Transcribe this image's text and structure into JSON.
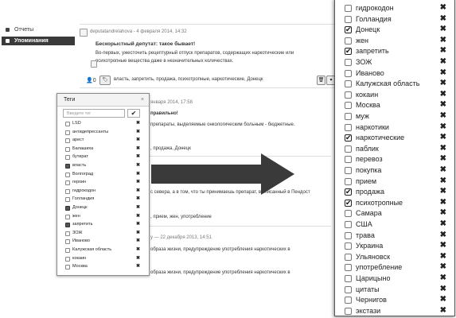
{
  "nav": {
    "items": [
      {
        "label": "Отчеты",
        "active": false
      },
      {
        "label": "Упоминания",
        "active": true
      }
    ]
  },
  "post": {
    "author_meta": "deputatandrelahova - 4 февраля 2014, 14:32",
    "title": "Бескорыстный депутат: такое бывает!",
    "body_line1": "Во-первых, ужесточить рецептурный отпуск препаратов, содержащих наркотические или",
    "body_line2": "психотропные вещества даже в незначительных количествах.",
    "count": "0",
    "tags_line": "власть, запретить, продажа, психотропные, наркотические, Донецк"
  },
  "feed": {
    "line1": "января 2014, 17:58",
    "line2": "правильно!",
    "line3": "препараты, выделяемые онкологическим больным - бюджетные.",
    "line4": ", продажа, Донецк",
    "line5": "с севера, а в том, что ты принимаешь препарат, выписанный в Пендост",
    "line6": ", прием, жен, употребление",
    "line7": "у — 22 декабря 2013, 14:51",
    "line8": "образа жизни, предупреждение употребления наркотических в",
    "line9": "образа жизни, предупреждение употребления наркотических в"
  },
  "popup": {
    "title": "Теги",
    "close": "×",
    "search_placeholder": "Введите тег",
    "tags": [
      {
        "label": "LSD",
        "checked": false
      },
      {
        "label": "антидепрессанты",
        "checked": false
      },
      {
        "label": "арест",
        "checked": false
      },
      {
        "label": "Балашиха",
        "checked": false
      },
      {
        "label": "бутират",
        "checked": false
      },
      {
        "label": "власть",
        "checked": true
      },
      {
        "label": "Волгоград",
        "checked": false
      },
      {
        "label": "героин",
        "checked": false
      },
      {
        "label": "гидрокодон",
        "checked": false
      },
      {
        "label": "Голландия",
        "checked": false
      },
      {
        "label": "Донецк",
        "checked": true
      },
      {
        "label": "жен",
        "checked": false
      },
      {
        "label": "запретить",
        "checked": true
      },
      {
        "label": "ЗОЖ",
        "checked": false
      },
      {
        "label": "Иваново",
        "checked": false
      },
      {
        "label": "Калужская область",
        "checked": false
      },
      {
        "label": "кокаин",
        "checked": false
      },
      {
        "label": "Москва",
        "checked": false
      }
    ]
  },
  "zoom": {
    "tags": [
      {
        "label": "гидрокодон",
        "checked": false
      },
      {
        "label": "Голландия",
        "checked": false
      },
      {
        "label": "Донецк",
        "checked": true
      },
      {
        "label": "жен",
        "checked": false
      },
      {
        "label": "запретить",
        "checked": true
      },
      {
        "label": "ЗОЖ",
        "checked": false
      },
      {
        "label": "Иваново",
        "checked": false
      },
      {
        "label": "Калужская область",
        "checked": false
      },
      {
        "label": "кокаин",
        "checked": false
      },
      {
        "label": "Москва",
        "checked": false
      },
      {
        "label": "муж",
        "checked": false
      },
      {
        "label": "наркотики",
        "checked": false
      },
      {
        "label": "наркотические",
        "checked": true
      },
      {
        "label": "паблик",
        "checked": false
      },
      {
        "label": "перевоз",
        "checked": false
      },
      {
        "label": "покупка",
        "checked": false
      },
      {
        "label": "прием",
        "checked": false
      },
      {
        "label": "продажа",
        "checked": true
      },
      {
        "label": "психотропные",
        "checked": true
      },
      {
        "label": "Самара",
        "checked": false
      },
      {
        "label": "США",
        "checked": false
      },
      {
        "label": "трава",
        "checked": false
      },
      {
        "label": "Украина",
        "checked": false
      },
      {
        "label": "Ульяновск",
        "checked": false
      },
      {
        "label": "употребление",
        "checked": false
      },
      {
        "label": "Царицыно",
        "checked": false
      },
      {
        "label": "цитаты",
        "checked": false
      },
      {
        "label": "Чернигов",
        "checked": false
      },
      {
        "label": "экстази",
        "checked": false
      }
    ]
  },
  "icons": {
    "remove": "✖",
    "ok": "✔"
  }
}
